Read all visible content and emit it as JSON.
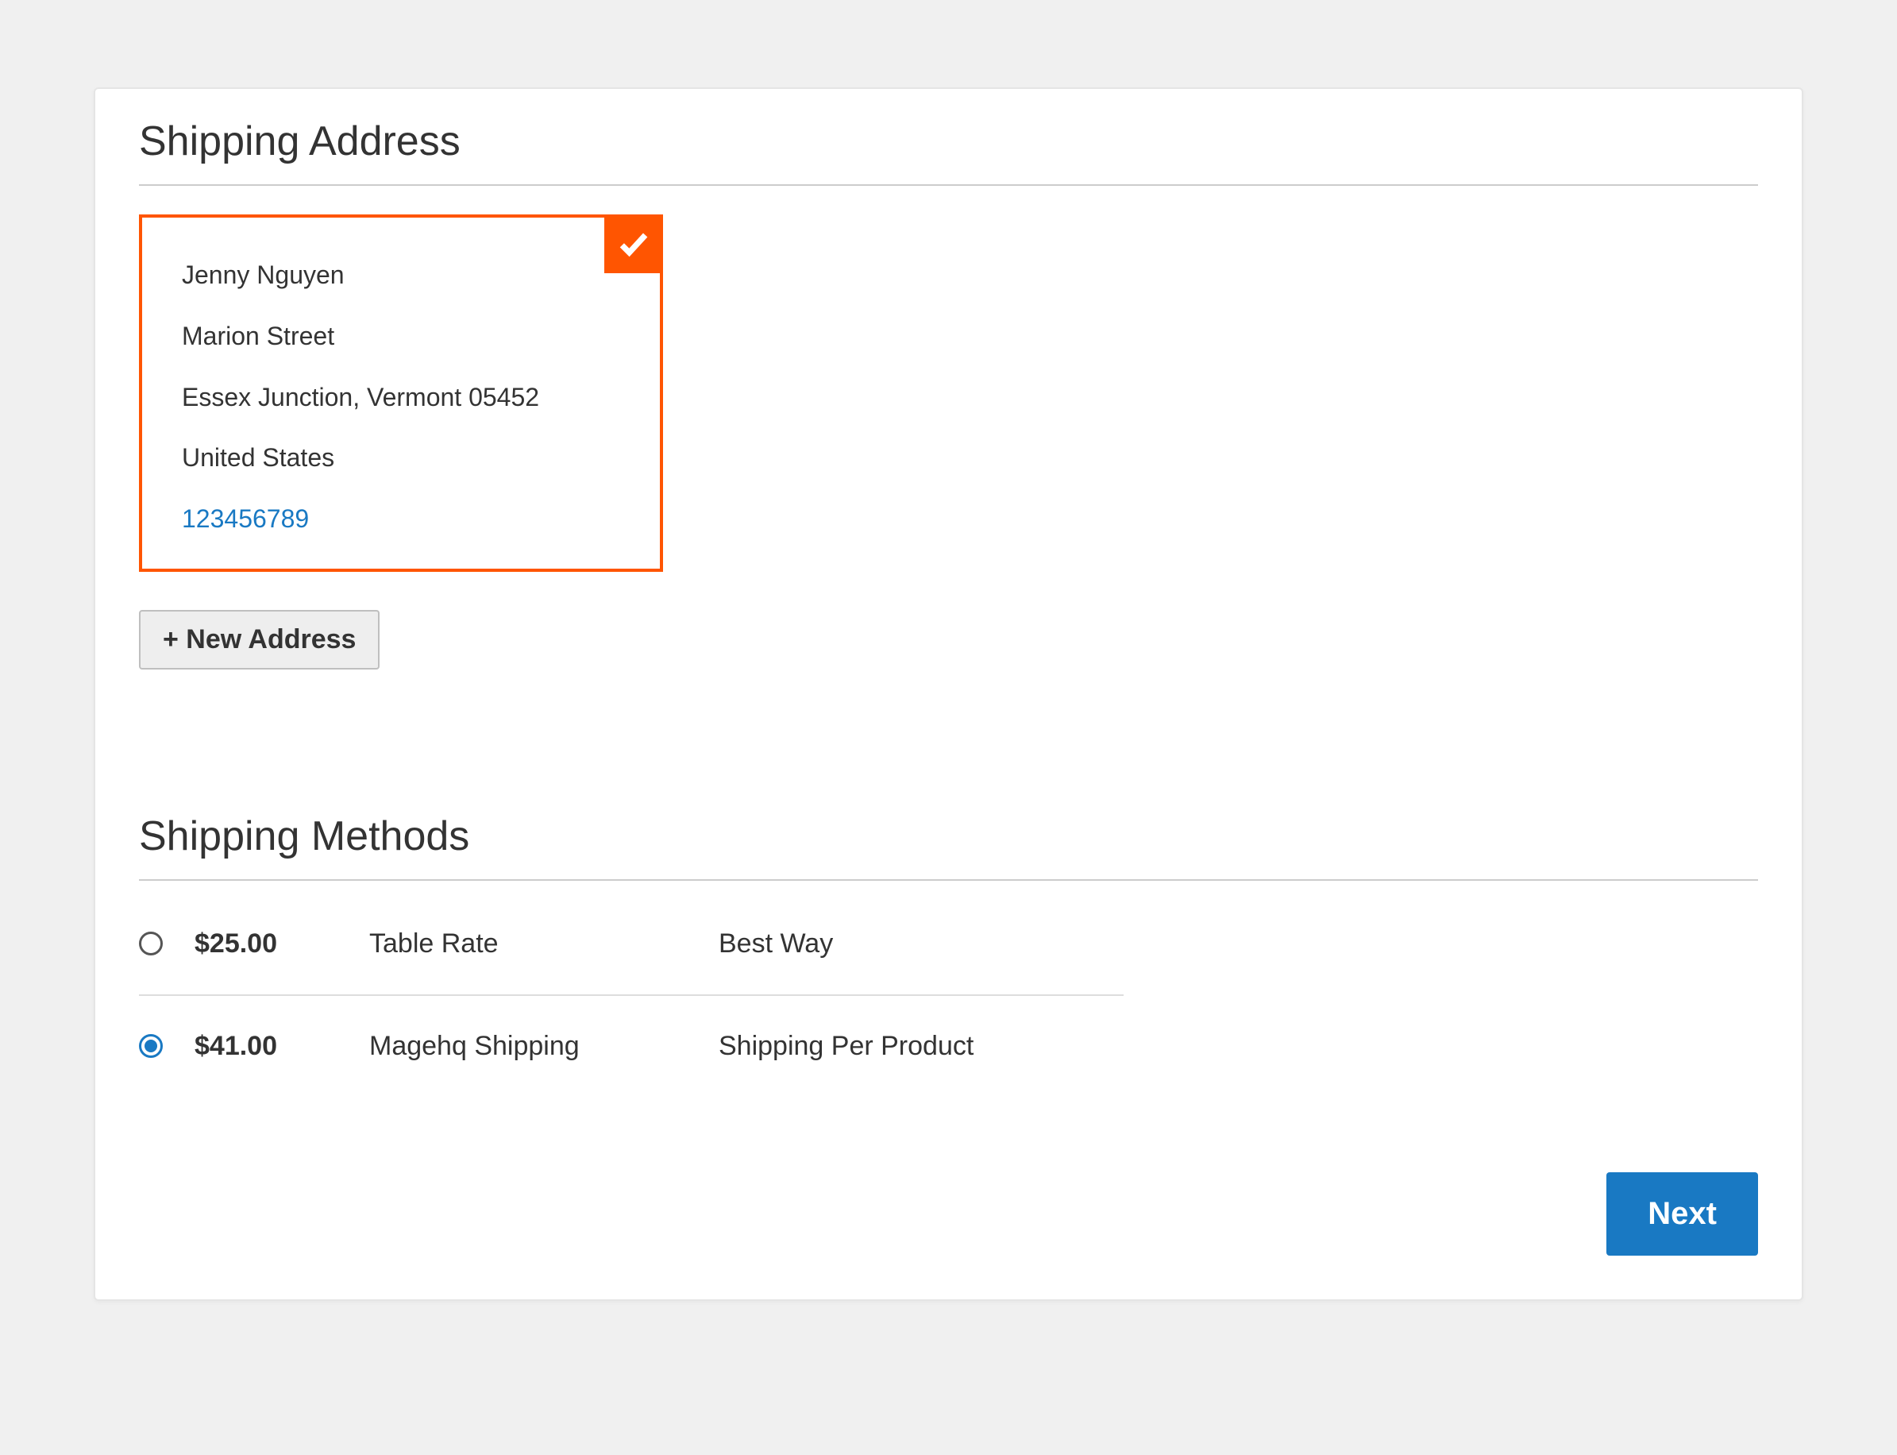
{
  "sections": {
    "shipping_address_title": "Shipping Address",
    "shipping_methods_title": "Shipping Methods"
  },
  "address": {
    "name": "Jenny Nguyen",
    "street": "Marion Street",
    "city_state_postal": "Essex Junction, Vermont 05452",
    "country": "United States",
    "phone": "123456789",
    "selected": true
  },
  "buttons": {
    "new_address": "+ New Address",
    "next": "Next"
  },
  "shipping_methods": [
    {
      "price": "$25.00",
      "method": "Table Rate",
      "carrier": "Best Way",
      "selected": false
    },
    {
      "price": "$41.00",
      "method": "Magehq Shipping",
      "carrier": "Shipping Per Product",
      "selected": true
    }
  ],
  "colors": {
    "accent_orange": "#ff5501",
    "accent_blue": "#1979c3"
  }
}
